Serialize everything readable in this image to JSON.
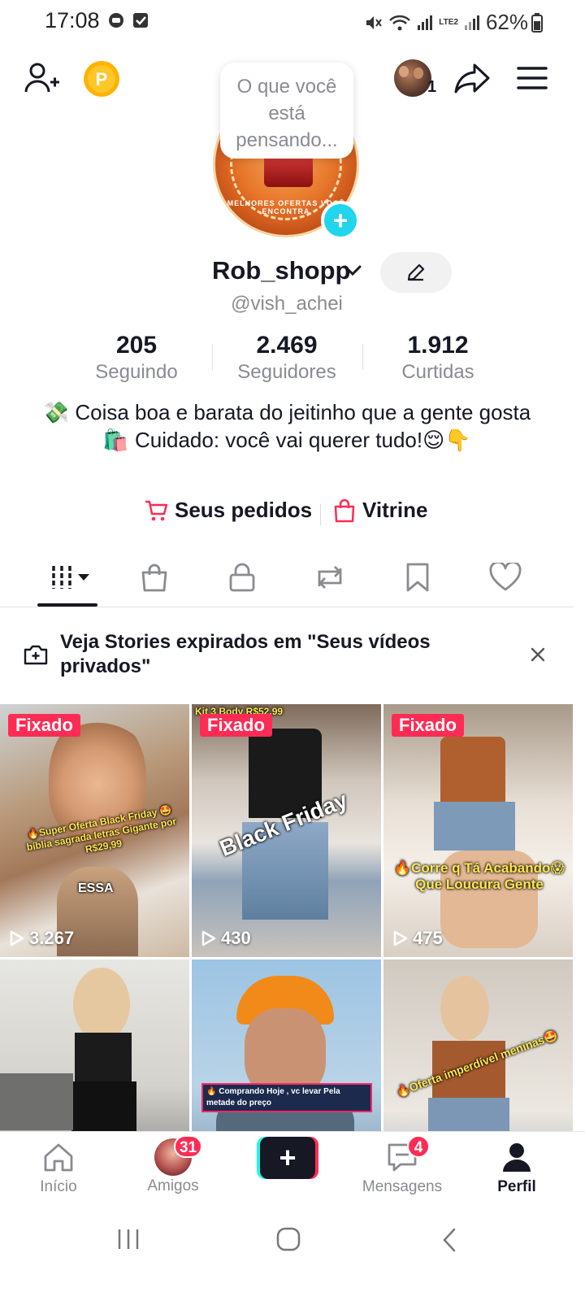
{
  "status_bar": {
    "time": "17:08",
    "network": "LTE2",
    "battery": "62%"
  },
  "header": {
    "follow_count_badge": "1"
  },
  "profile": {
    "bubble_text": "O que você está pensando...",
    "avatar_text": "MELHORES OFERTAS VOCÊ ENCONTRA",
    "username": "Rob_shopp",
    "handle": "@vish_achei"
  },
  "stats": [
    {
      "value": "205",
      "label": "Seguindo"
    },
    {
      "value": "2.469",
      "label": "Seguidores"
    },
    {
      "value": "1.912",
      "label": "Curtidas"
    }
  ],
  "bio": {
    "line1": "💸 Coisa boa e barata do jeitinho que a gente gosta",
    "line2": "🛍️ Cuidado: você vai querer tudo!😌👇"
  },
  "links": {
    "orders": "Seus pedidos",
    "showcase": "Vitrine"
  },
  "stories_banner": {
    "text": "Veja Stories expirados em \"Seus vídeos privados\""
  },
  "grid": [
    {
      "pinned": "Fixado",
      "views": "3.267",
      "caption": "🔥Super Oferta Black Friday 🤩 bíblia sagrada letras Gigante por R$29,99",
      "overlay": "ESSA"
    },
    {
      "pinned": "Fixado",
      "views": "430",
      "caption": "Black Friday",
      "top_text": "Kit 3 Body R$52,99"
    },
    {
      "pinned": "Fixado",
      "views": "475",
      "caption": "🔥Corre q Tá Acabando😱 Que Loucura Gente"
    },
    {
      "views": "",
      "caption": ""
    },
    {
      "views": "",
      "caption": "🔥 Comprando Hoje , vc levar Pela metade do preço"
    },
    {
      "views": "",
      "caption": "🔥Oferta imperdível meninas🤩"
    }
  ],
  "bottom_nav": {
    "home": "Início",
    "friends": "Amigos",
    "friends_badge": "31",
    "create": "+",
    "messages": "Mensagens",
    "messages_badge": "4",
    "profile": "Perfil"
  },
  "colors": {
    "accent": "#fe2c55",
    "cyan": "#25f4ee",
    "text": "#161823",
    "muted": "#8a8b91"
  }
}
